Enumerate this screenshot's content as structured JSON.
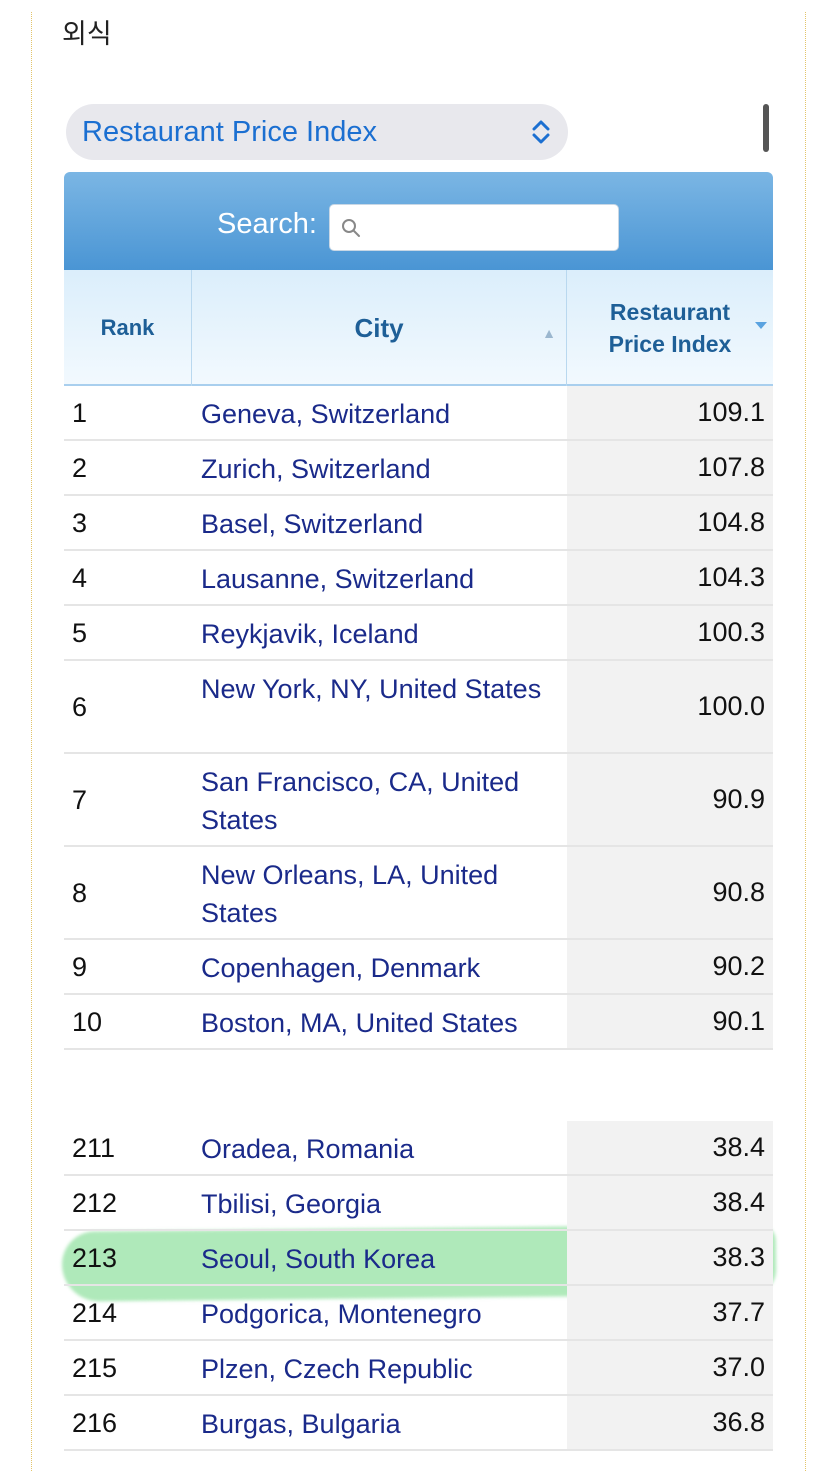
{
  "section_title": "외식",
  "selector": {
    "label": "Restaurant Price Index"
  },
  "search": {
    "label": "Search:",
    "placeholder": ""
  },
  "columns": {
    "rank": "Rank",
    "city": "City",
    "index": "Restaurant Price Index"
  },
  "top_rows": [
    {
      "rank": "1",
      "city": "Geneva, Switzerland",
      "index": "109.1"
    },
    {
      "rank": "2",
      "city": "Zurich, Switzerland",
      "index": "107.8"
    },
    {
      "rank": "3",
      "city": "Basel, Switzerland",
      "index": "104.8"
    },
    {
      "rank": "4",
      "city": "Lausanne, Switzerland",
      "index": "104.3"
    },
    {
      "rank": "5",
      "city": "Reykjavik, Iceland",
      "index": "100.3"
    },
    {
      "rank": "6",
      "city": "New York, NY, United States",
      "index": "100.0"
    },
    {
      "rank": "7",
      "city": "San Francisco, CA, United States",
      "index": "90.9"
    },
    {
      "rank": "8",
      "city": "New Orleans, LA, United States",
      "index": "90.8"
    },
    {
      "rank": "9",
      "city": "Copenhagen, Denmark",
      "index": "90.2"
    },
    {
      "rank": "10",
      "city": "Boston, MA, United States",
      "index": "90.1"
    }
  ],
  "bottom_rows": [
    {
      "rank": "211",
      "city": "Oradea, Romania",
      "index": "38.4"
    },
    {
      "rank": "212",
      "city": "Tbilisi, Georgia",
      "index": "38.4"
    },
    {
      "rank": "213",
      "city": "Seoul, South Korea",
      "index": "38.3"
    },
    {
      "rank": "214",
      "city": "Podgorica, Montenegro",
      "index": "37.7"
    },
    {
      "rank": "215",
      "city": "Plzen, Czech Republic",
      "index": "37.0"
    },
    {
      "rank": "216",
      "city": "Burgas, Bulgaria",
      "index": "36.8"
    }
  ],
  "highlight": {
    "rank": "213",
    "color": "#6ed782"
  },
  "colors": {
    "accent": "#1b6fd1",
    "header_blue": "#4a95d4",
    "link": "#1a2a8a"
  }
}
